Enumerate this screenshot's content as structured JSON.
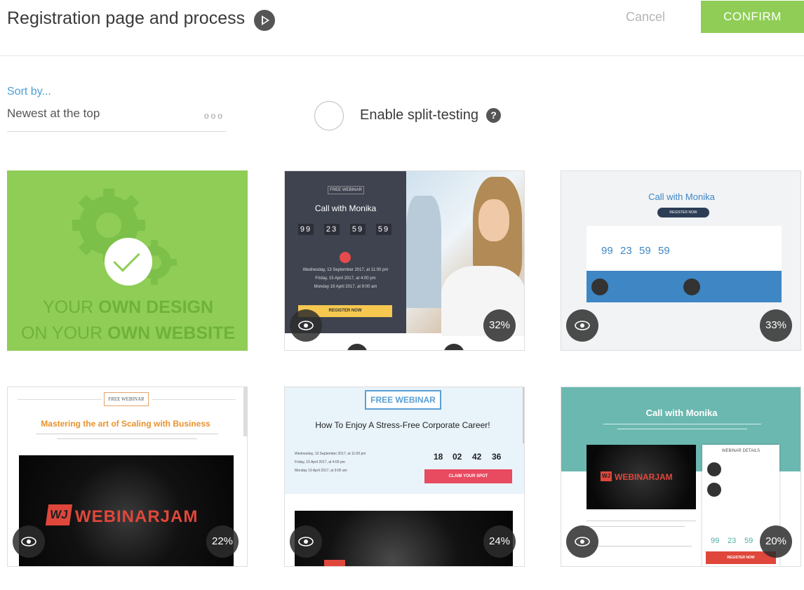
{
  "header": {
    "title": "Registration page and process",
    "cancel_label": "Cancel",
    "confirm_label": "CONFIRM"
  },
  "sort": {
    "label": "Sort by...",
    "value": "Newest at the top",
    "more": "ooo"
  },
  "split_testing": {
    "label": "Enable split-testing",
    "help": "?"
  },
  "colors": {
    "accent_green": "#8fcd56",
    "link_blue": "#4a9fd6"
  },
  "cards": [
    {
      "line1_a": "YOUR ",
      "line1_b": "OWN DESIGN",
      "line2_a": "ON YOUR ",
      "line2_b": "OWN WEBSITE"
    },
    {
      "badge": "FREE WEBINAR",
      "title": "Call with Monika",
      "countdown": [
        "99",
        "23",
        "59",
        "59"
      ],
      "dates": [
        "Wednesday, 13 September 2017, at 11:00 pm",
        "Friday, 15 April 2017, at 4:00 pm",
        "Monday 19 April 2017, at 9:00 am"
      ],
      "button": "REGISTER NOW",
      "percent": "32%"
    },
    {
      "title": "Call with Monika",
      "button": "REGISTER NOW",
      "countdown": [
        "99",
        "23",
        "59",
        "59"
      ],
      "percent": "33%"
    },
    {
      "badge": "FREE WEBINAR",
      "title": "Mastering the art of Scaling with Business",
      "logo_mark": "WJ",
      "logo_text": "WEBINARJAM",
      "percent": "22%"
    },
    {
      "badge": "FREE WEBINAR",
      "title": "How To Enjoy A Stress-Free Corporate Career!",
      "countdown": [
        "18",
        "02",
        "42",
        "36"
      ],
      "dates": [
        "Wednesday, 13 September 2017, at 11:00 pm",
        "Friday, 15 April 2017, at 4:00 pm",
        "Monday 19 April 2017, at 9:00 am"
      ],
      "button": "CLAIM YOUR SPOT",
      "percent": "24%"
    },
    {
      "title": "Call with Monika",
      "logo_mark": "WJ",
      "logo_text": "WEBINARJAM",
      "panel_title": "WEBINAR DETAILS",
      "countdown": [
        "99",
        "23",
        "59"
      ],
      "button": "REGISTER NOW",
      "percent": "20%"
    }
  ]
}
